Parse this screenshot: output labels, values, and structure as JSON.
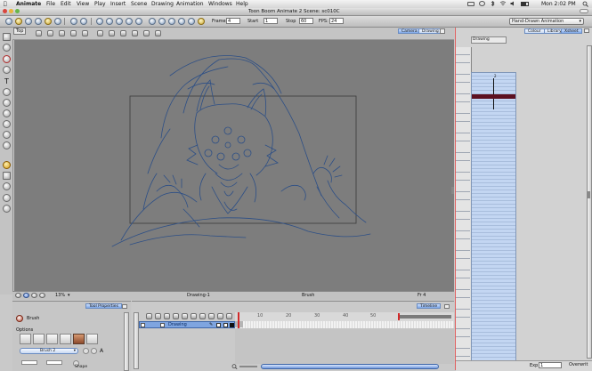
{
  "menubar": {
    "apple": "",
    "app_name": "Animate",
    "items": [
      "File",
      "Edit",
      "View",
      "Play",
      "Insert",
      "Scene",
      "Drawing",
      "Animation",
      "Windows",
      "Help"
    ],
    "clock": "Mon 2:02 PM"
  },
  "window": {
    "title": "Toon Boom Animate 2 Scene: sc010C"
  },
  "toolbar": {
    "frame_label": "Frame",
    "frame_value": "4",
    "start_label": "Start",
    "start_value": "1",
    "stop_label": "Stop",
    "stop_value": "60",
    "fps_label": "FPS:",
    "fps_value": "24",
    "workspace": "Hand-Drawn Animation"
  },
  "view": {
    "top_tab": "Top",
    "tabs": [
      "Camera",
      "Drawing"
    ],
    "active_tab": "Camera",
    "zoom": "13%",
    "status_drawing": "Drawing-1",
    "status_tool": "Brush",
    "status_frame": "Fr 4"
  },
  "tool_properties": {
    "tab": "Tool Properties",
    "tool_name": "Brush",
    "options_label": "Options",
    "preset": "Brush 2",
    "shape_label": "Shape"
  },
  "timeline": {
    "tab": "Timeline",
    "layer_name": "Drawing",
    "ruler": [
      "10",
      "20",
      "30",
      "40",
      "50"
    ]
  },
  "xsheet": {
    "tabs": [
      "Colour",
      "Library",
      "Xsheet"
    ],
    "active_tab": "Xsheet",
    "column_name": "Drawing",
    "first_value": "2",
    "exp_label": "Exp",
    "exp_value": "1",
    "mode": "Overwrit"
  },
  "colors": {
    "accent": "#4a74c9",
    "canvas": "#7d7d7d",
    "sketch": "#2d4f86",
    "selected_cell": "#5c1020",
    "playhead": "#d22a2a"
  }
}
